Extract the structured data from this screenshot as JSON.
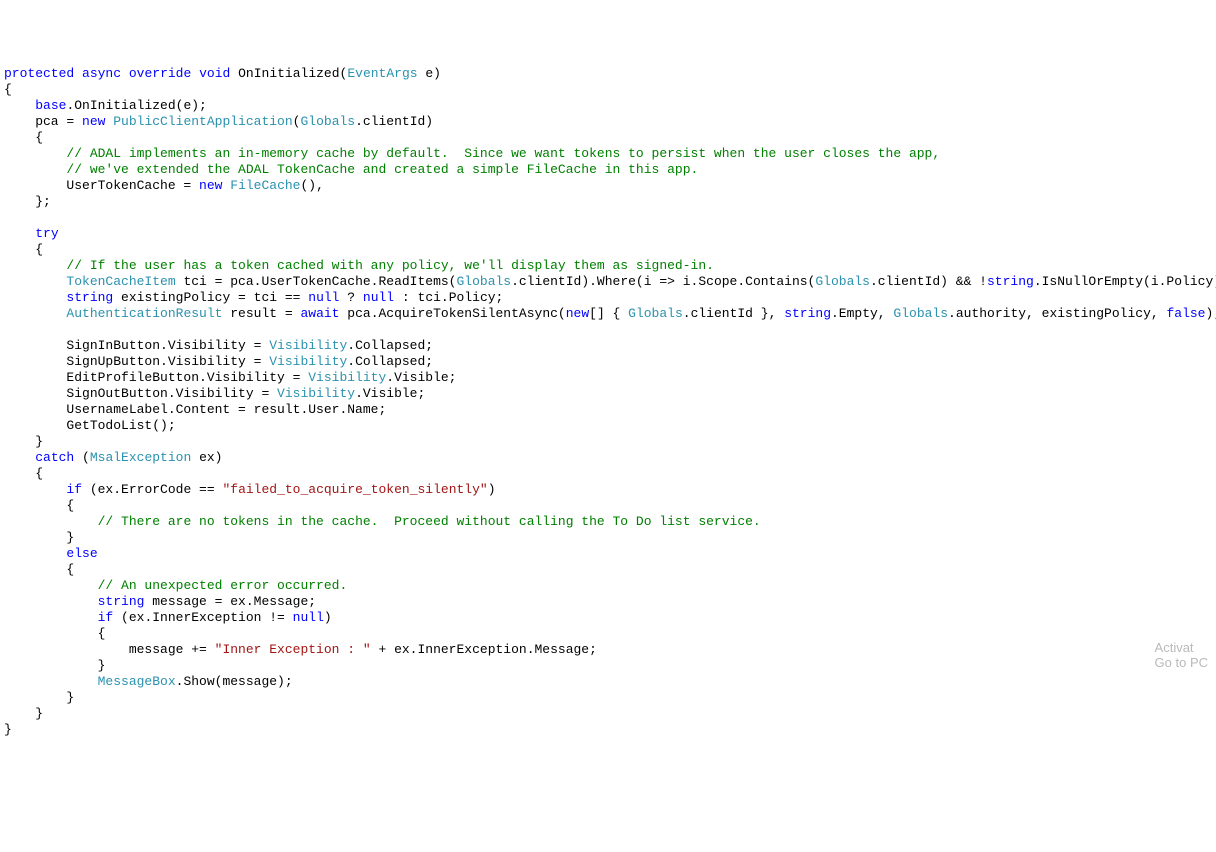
{
  "code": {
    "l1": {
      "a": "protected",
      "b": "async",
      "c": "override",
      "d": "void",
      "e": " OnInitialized(",
      "f": "EventArgs",
      "g": " e)"
    },
    "l2": "{",
    "l3": {
      "a": "    ",
      "b": "base",
      "c": ".OnInitialized(e);"
    },
    "l4": {
      "a": "    pca = ",
      "b": "new",
      "c": " ",
      "d": "PublicClientApplication",
      "e": "(",
      "f": "Globals",
      "g": ".clientId)"
    },
    "l5": "    {",
    "l6": {
      "a": "        ",
      "b": "// ADAL implements an in-memory cache by default.  Since we want tokens to persist when the user closes the app,"
    },
    "l7": {
      "a": "        ",
      "b": "// we've extended the ADAL TokenCache and created a simple FileCache in this app."
    },
    "l8": {
      "a": "        UserTokenCache = ",
      "b": "new",
      "c": " ",
      "d": "FileCache",
      "e": "(),"
    },
    "l9": "    };",
    "l10": "",
    "l11": {
      "a": "    ",
      "b": "try"
    },
    "l12": "    {",
    "l13": {
      "a": "        ",
      "b": "// If the user has a token cached with any policy, we'll display them as signed-in."
    },
    "l14": {
      "a": "        ",
      "b": "TokenCacheItem",
      "c": " tci = pca.UserTokenCache.ReadItems(",
      "d": "Globals",
      "e": ".clientId).Where(i => i.Scope.Contains(",
      "f": "Globals",
      "g": ".clientId) && !",
      "h": "string",
      "i": ".IsNullOrEmpty(i.Policy)).FirstOrDefault("
    },
    "l15": {
      "a": "        ",
      "b": "string",
      "c": " existingPolicy = tci == ",
      "d": "null",
      "e": " ? ",
      "f": "null",
      "g": " : tci.Policy;"
    },
    "l16": {
      "a": "        ",
      "b": "AuthenticationResult",
      "c": " result = ",
      "d": "await",
      "e": " pca.AcquireTokenSilentAsync(",
      "f": "new",
      "g": "[] { ",
      "h": "Globals",
      "i": ".clientId }, ",
      "j": "string",
      "k": ".Empty, ",
      "l": "Globals",
      "m": ".authority, existingPolicy, ",
      "n": "false",
      "o": ");"
    },
    "l17": "",
    "l18": {
      "a": "        SignInButton.Visibility = ",
      "b": "Visibility",
      "c": ".Collapsed;"
    },
    "l19": {
      "a": "        SignUpButton.Visibility = ",
      "b": "Visibility",
      "c": ".Collapsed;"
    },
    "l20": {
      "a": "        EditProfileButton.Visibility = ",
      "b": "Visibility",
      "c": ".Visible;"
    },
    "l21": {
      "a": "        SignOutButton.Visibility = ",
      "b": "Visibility",
      "c": ".Visible;"
    },
    "l22": "        UsernameLabel.Content = result.User.Name;",
    "l23": "        GetTodoList();",
    "l24": "    }",
    "l25": {
      "a": "    ",
      "b": "catch",
      "c": " (",
      "d": "MsalException",
      "e": " ex)"
    },
    "l26": "    {",
    "l27": {
      "a": "        ",
      "b": "if",
      "c": " (ex.ErrorCode == ",
      "d": "\"failed_to_acquire_token_silently\"",
      "e": ")"
    },
    "l28": "        {",
    "l29": {
      "a": "            ",
      "b": "// There are no tokens in the cache.  Proceed without calling the To Do list service."
    },
    "l30": "        }",
    "l31": {
      "a": "        ",
      "b": "else"
    },
    "l32": "        {",
    "l33": {
      "a": "            ",
      "b": "// An unexpected error occurred."
    },
    "l34": {
      "a": "            ",
      "b": "string",
      "c": " message = ex.Message;"
    },
    "l35": {
      "a": "            ",
      "b": "if",
      "c": " (ex.InnerException != ",
      "d": "null",
      "e": ")"
    },
    "l36": "            {",
    "l37": {
      "a": "                message += ",
      "b": "\"Inner Exception : \"",
      "c": " + ex.InnerException.Message;"
    },
    "l38": "            }",
    "l39": {
      "a": "            ",
      "b": "MessageBox",
      "c": ".Show(message);"
    },
    "l40": "        }",
    "l41": "    }",
    "l42": "}"
  },
  "watermark": {
    "line1": "Activat",
    "line2": "Go to PC"
  }
}
